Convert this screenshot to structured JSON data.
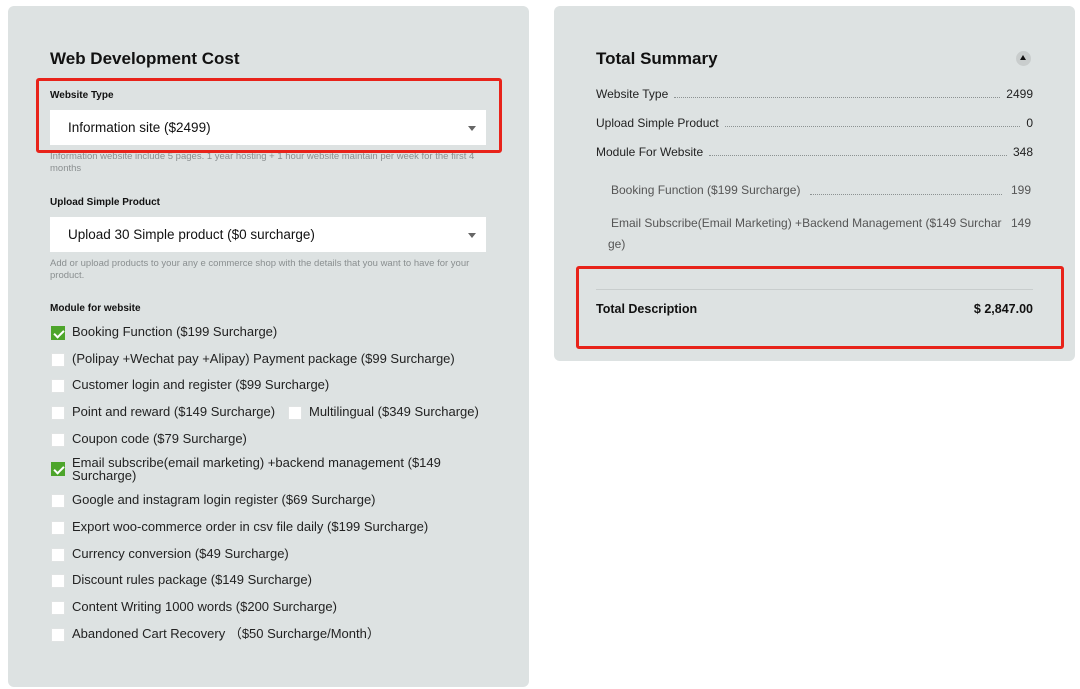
{
  "left": {
    "title": "Web Development Cost",
    "website_type": {
      "label": "Website Type",
      "value": "Information site ($2499)",
      "help": "Information website include 5 pages. 1 year hosting + 1 hour website maintain per week for the first 4 months"
    },
    "upload": {
      "label": "Upload Simple Product",
      "value": "Upload 30 Simple product ($0 surcharge)",
      "help": "Add or upload products to your any e commerce shop with the details that you want to have for your product."
    },
    "modules": {
      "label": "Module for website",
      "items": [
        {
          "label": "Booking Function ($199 Surcharge)",
          "checked": true
        },
        {
          "label": "(Polipay +Wechat pay +Alipay) Payment package ($99 Surcharge)",
          "checked": false
        },
        {
          "label": "Customer login and register ($99 Surcharge)",
          "checked": false
        },
        {
          "label": "Point and reward ($149 Surcharge)",
          "checked": false
        },
        {
          "label": "Multilingual ($349 Surcharge)",
          "checked": false
        },
        {
          "label": "Coupon code ($79 Surcharge)",
          "checked": false
        },
        {
          "label": "Email subscribe(email marketing) +backend management ($149 Surcharge)",
          "checked": true
        },
        {
          "label": "Google and instagram login register ($69 Surcharge)",
          "checked": false
        },
        {
          "label": "Export woo-commerce order in csv file daily ($199 Surcharge)",
          "checked": false
        },
        {
          "label": "Currency conversion ($49 Surcharge)",
          "checked": false
        },
        {
          "label": "Discount rules package ($149 Surcharge)",
          "checked": false
        },
        {
          "label": "Content Writing 1000 words ($200 Surcharge)",
          "checked": false
        },
        {
          "label": "Abandoned Cart Recovery （$50 Surcharge/Month）",
          "checked": false
        }
      ]
    }
  },
  "summary": {
    "title": "Total Summary",
    "rows": [
      {
        "label": "Website Type",
        "value": "2499"
      },
      {
        "label": "Upload Simple Product",
        "value": "0"
      },
      {
        "label": "Module For Website",
        "value": "348"
      }
    ],
    "subrows": [
      {
        "label": "Booking Function ($199 Surcharge)",
        "value": "199"
      },
      {
        "label_line1": "Email Subscribe(Email Marketing) +Backend Management ($149 Surchar",
        "label_line2": "ge)",
        "value": "149"
      }
    ],
    "total_label": "Total Description",
    "total_value": "$ 2,847.00"
  },
  "colors": {
    "panel_bg": "#dde2e2",
    "checkbox_checked": "#4da52b",
    "highlight_box": "#e8231a"
  }
}
